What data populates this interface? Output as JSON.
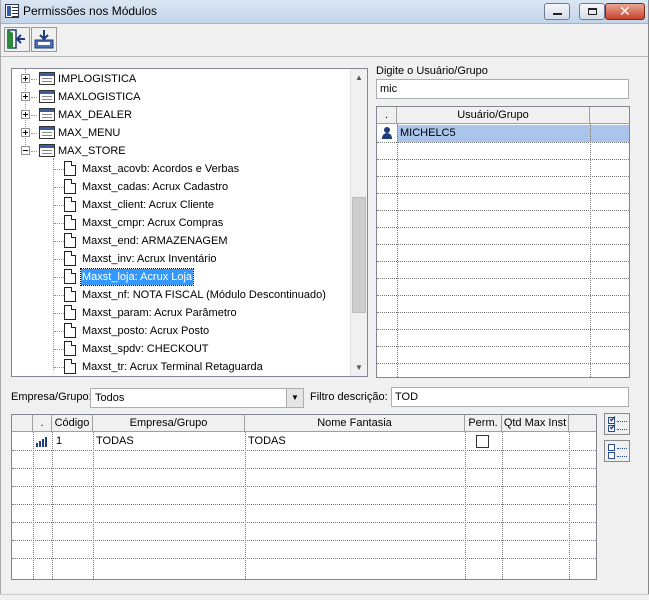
{
  "window": {
    "title": "Permissões nos Módulos"
  },
  "toolbar": {
    "exit_icon": "exit-door-icon",
    "save_icon": "save-download-icon"
  },
  "tree": {
    "groups": [
      {
        "label": "IMPLOGISTICA",
        "expanded": false
      },
      {
        "label": "MAXLOGISTICA",
        "expanded": false
      },
      {
        "label": "MAX_DEALER",
        "expanded": false
      },
      {
        "label": "MAX_MENU",
        "expanded": false
      },
      {
        "label": "MAX_STORE",
        "expanded": true
      }
    ],
    "children": [
      {
        "label": "Maxst_acovb: Acordos e Verbas"
      },
      {
        "label": "Maxst_cadas: Acrux Cadastro"
      },
      {
        "label": "Maxst_client: Acrux Cliente"
      },
      {
        "label": "Maxst_cmpr: Acrux Compras"
      },
      {
        "label": "Maxst_end: ARMAZENAGEM"
      },
      {
        "label": "Maxst_inv: Acrux Inventário"
      },
      {
        "label": "Maxst_loja: Acrux Loja",
        "selected": true
      },
      {
        "label": "Maxst_nf: NOTA FISCAL (Módulo Descontinuado)"
      },
      {
        "label": "Maxst_param: Acrux Parâmetro"
      },
      {
        "label": "Maxst_posto: Acrux Posto"
      },
      {
        "label": "Maxst_spdv: CHECKOUT"
      },
      {
        "label": "Maxst_tr: Acrux Terminal Retaguarda"
      }
    ]
  },
  "user_search": {
    "label": "Digite o Usuário/Grupo",
    "value": "mic"
  },
  "user_grid": {
    "columns": [
      ".",
      "Usuário/Grupo"
    ],
    "rows": [
      {
        "icon": "user-icon",
        "name": "MICHELC5",
        "selected": true
      }
    ]
  },
  "filters": {
    "empresa_label": "Empresa/Grupo:",
    "empresa_value": "Todos",
    "descricao_label": "Filtro descrição:",
    "descricao_value": "TOD"
  },
  "company_grid": {
    "columns": [
      ".",
      "Código",
      "Empresa/Grupo",
      "Nome Fantasia",
      "Perm.",
      "Qtd Max Inst"
    ],
    "rows": [
      {
        "icon": "group-bars-icon",
        "codigo": "1",
        "empresa": "TODAS",
        "fantasia": "TODAS",
        "perm": false,
        "qtd": ""
      }
    ]
  },
  "side_buttons": {
    "check_all_icon": "check-all-icon",
    "uncheck_all_icon": "uncheck-all-icon"
  }
}
